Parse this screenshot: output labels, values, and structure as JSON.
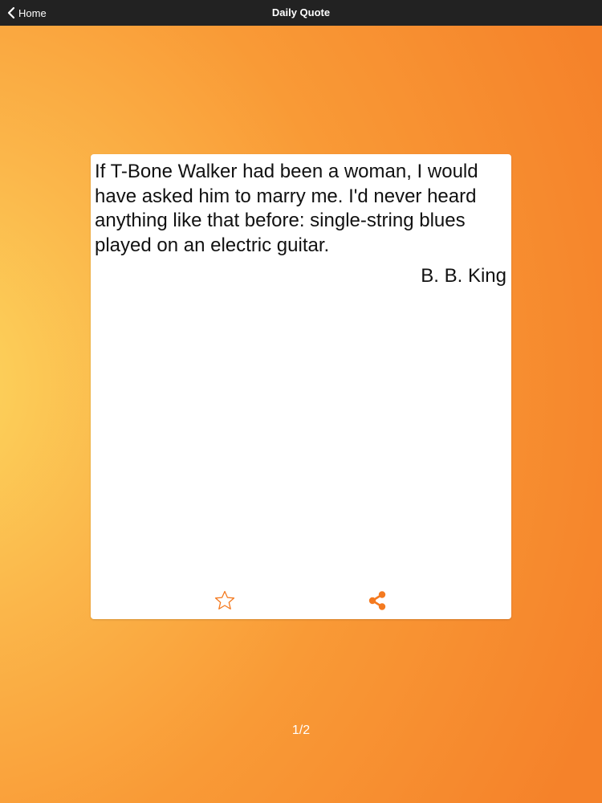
{
  "navbar": {
    "back_label": "Home",
    "title": "Daily Quote",
    "back_icon": "chevron-left-icon"
  },
  "quote": {
    "text": "If T-Bone Walker had been a woman, I would have asked him to marry me. I'd never heard anything like that before: single-string blues played on an electric guitar.",
    "author": "B. B. King"
  },
  "actions": {
    "favorite_icon": "star-outline-icon",
    "share_icon": "share-icon"
  },
  "pagination": {
    "indicator": "1/2"
  },
  "colors": {
    "navbar_bg": "#222222",
    "accent": "#f47a20",
    "background_light": "#fcd75e",
    "background_dark": "#f5822a",
    "card_bg": "#ffffff"
  }
}
